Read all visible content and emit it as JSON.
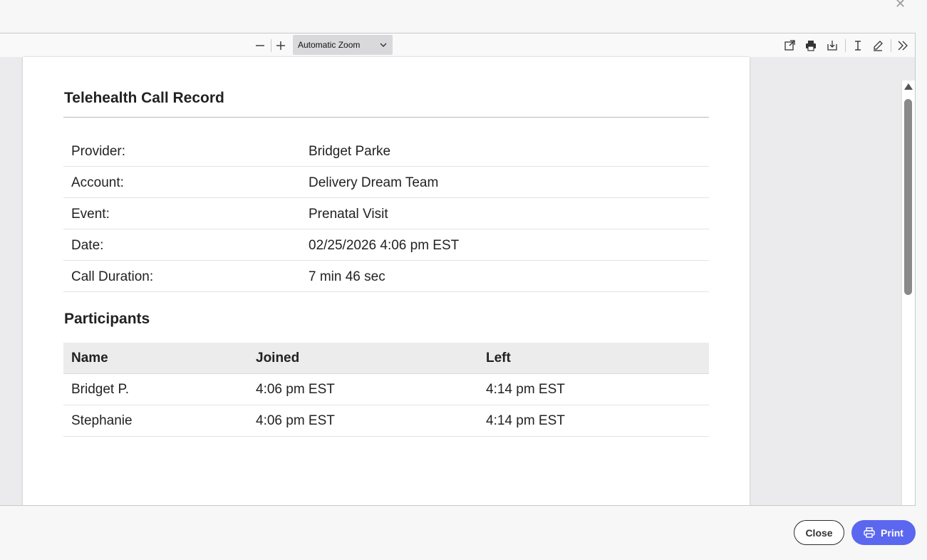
{
  "viewer": {
    "zoom_label": "Automatic Zoom",
    "zoom_out_icon": "minus-icon",
    "zoom_in_icon": "plus-icon"
  },
  "document": {
    "title": "Telehealth Call Record",
    "fields": [
      {
        "label": "Provider:",
        "value": "Bridget Parke"
      },
      {
        "label": "Account:",
        "value": "Delivery Dream Team"
      },
      {
        "label": "Event:",
        "value": "Prenatal Visit"
      },
      {
        "label": "Date:",
        "value": "02/25/2026 4:06 pm EST"
      },
      {
        "label": "Call Duration:",
        "value": "7 min 46 sec"
      }
    ],
    "participants_title": "Participants",
    "participants_headers": [
      "Name",
      "Joined",
      "Left"
    ],
    "participants": [
      {
        "name": "Bridget P.",
        "joined": "4:06 pm EST",
        "left": "4:14 pm EST"
      },
      {
        "name": "Stephanie",
        "joined": "4:06 pm EST",
        "left": "4:14 pm EST"
      }
    ]
  },
  "footer": {
    "close_label": "Close",
    "print_label": "Print"
  },
  "colors": {
    "print_button": "#5b67ef"
  }
}
